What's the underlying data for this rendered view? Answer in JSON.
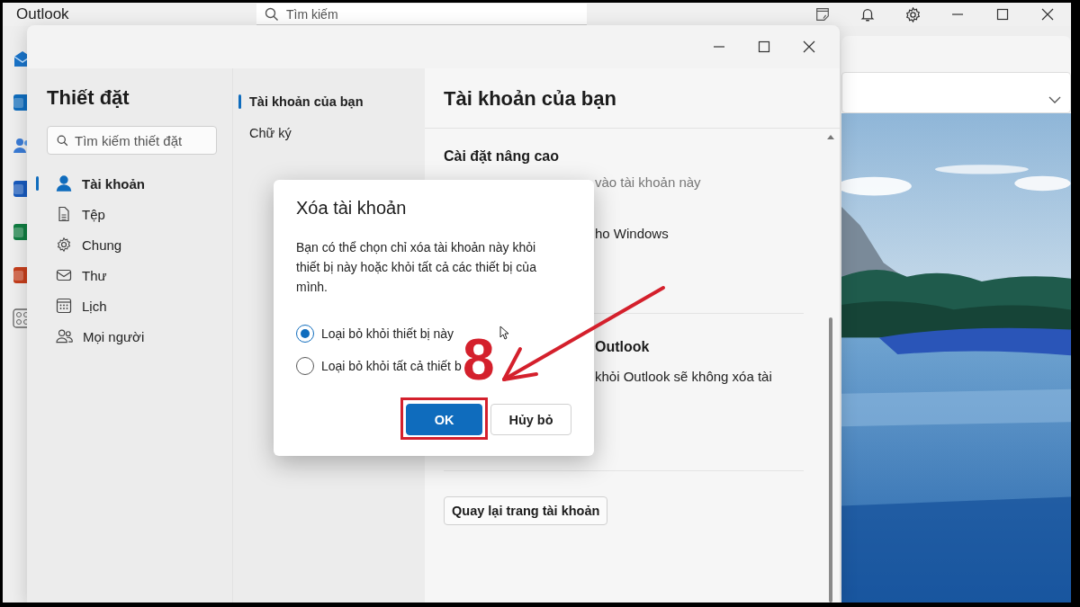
{
  "app": {
    "title": "Outlook",
    "search": {
      "placeholder": "Tìm kiếm"
    }
  },
  "rail_apps": [
    {
      "kind": "mail"
    },
    {
      "kind": "outlook"
    },
    {
      "kind": "people"
    },
    {
      "kind": "word"
    },
    {
      "kind": "excel"
    },
    {
      "kind": "powerpoint"
    },
    {
      "kind": "apps"
    }
  ],
  "settings": {
    "title": "Thiết đặt",
    "search": {
      "placeholder": "Tìm kiếm thiết đặt"
    },
    "nav": [
      {
        "label": "Tài khoản",
        "kind": "person",
        "selected": true
      },
      {
        "label": "Tệp",
        "kind": "file",
        "selected": false
      },
      {
        "label": "Chung",
        "kind": "gear",
        "selected": false
      },
      {
        "label": "Thư",
        "kind": "mail",
        "selected": false
      },
      {
        "label": "Lịch",
        "kind": "calendar",
        "selected": false
      },
      {
        "label": "Mọi người",
        "kind": "people",
        "selected": false
      }
    ],
    "subnav": [
      {
        "label": "Tài khoản của bạn",
        "selected": true
      },
      {
        "label": "Chữ ký",
        "selected": false
      }
    ],
    "content": {
      "title": "Tài khoản của bạn",
      "sections": [
        {
          "heading": "Cài đặt nâng cao",
          "heading_covered": false,
          "lines": [
            {
              "text": "vào tài khoản này",
              "kind": "description",
              "covered": true
            },
            {
              "text": "ho Windows",
              "kind": "body",
              "covered": true
            }
          ]
        },
        {
          "heading": "Outlook",
          "heading_covered": true,
          "lines": [
            {
              "text": "khỏi Outlook sẽ không xóa tài",
              "kind": "body",
              "covered": true
            }
          ]
        }
      ],
      "back_button": "Quay lại trang tài khoản"
    }
  },
  "dialog": {
    "title": "Xóa tài khoản",
    "message": "Bạn có thể chọn chỉ xóa tài khoản này khỏi thiết bị này hoặc khỏi tất cả các thiết bị của mình.",
    "options": [
      {
        "label": "Loại bỏ khỏi thiết bị này",
        "selected": true
      },
      {
        "label": "Loại bỏ khỏi tất cả thiết b",
        "selected": false
      }
    ],
    "buttons": [
      {
        "label": "OK",
        "kind": "primary",
        "highlighted": true
      },
      {
        "label": "Hủy bỏ",
        "kind": "secondary",
        "highlighted": false
      }
    ]
  },
  "annotation": {
    "step": "8"
  }
}
